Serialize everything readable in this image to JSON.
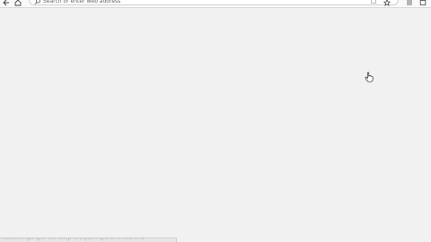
{
  "toolbar": {
    "back_icon": "back-arrow-icon",
    "home_icon": "home-icon",
    "bookmark_icon": "star-icon",
    "collections_icon": "collections-icon",
    "menu_icon": "menu-icon"
  },
  "address_bar": {
    "placeholder": "Search or enter web address",
    "value": ""
  },
  "status_bar": {
    "text": "········ ·· ·/·· ·/··· ···· ·····/· ·· ···/··· · ·/··· ·· ·· ····· ·· ··"
  },
  "colors": {
    "page_background": "#f1f1f1",
    "toolbar_background": "#f9f9f9"
  }
}
